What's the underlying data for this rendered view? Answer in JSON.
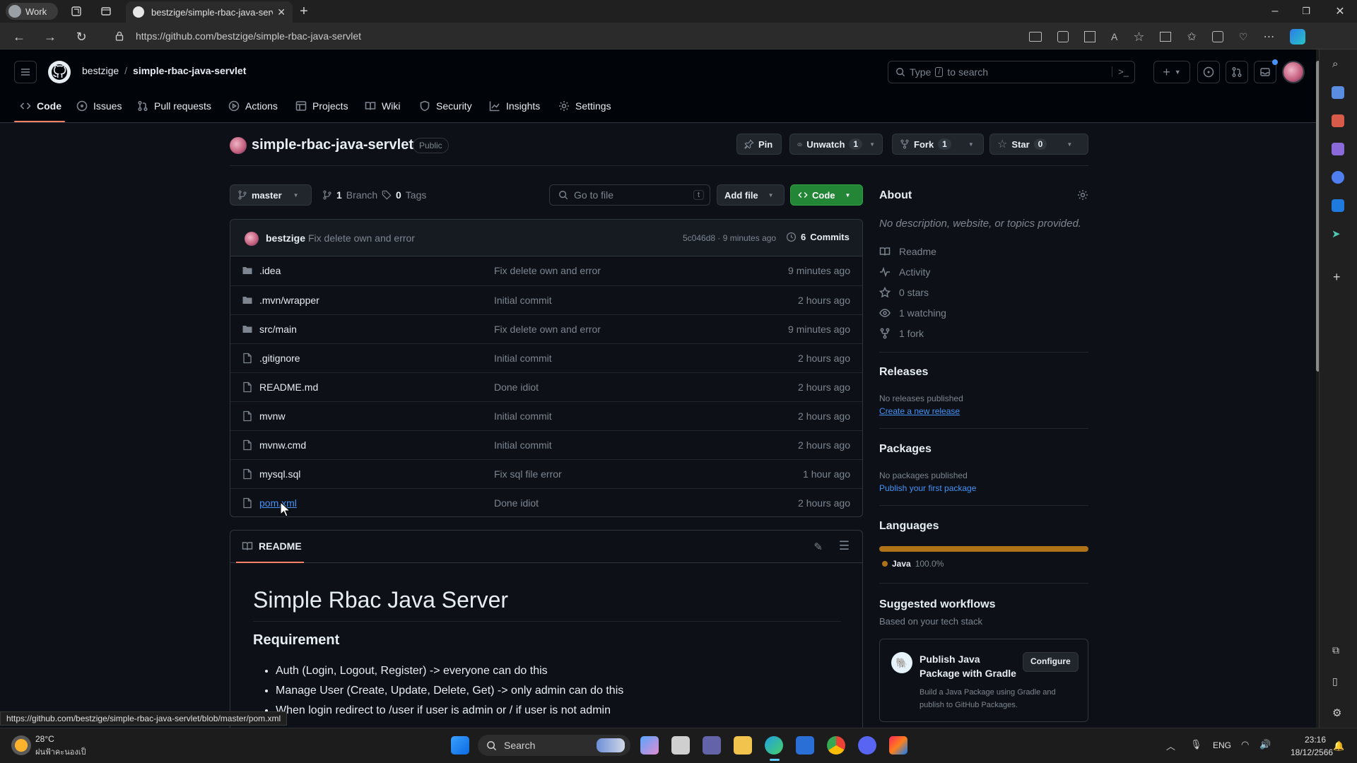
{
  "browser": {
    "profile_label": "Work",
    "tab_title": "bestzige/simple-rbac-java-servle",
    "url": "https://github.com/bestzige/simple-rbac-java-servlet",
    "status_url": "https://github.com/bestzige/simple-rbac-java-servlet/blob/master/pom.xml"
  },
  "header": {
    "owner": "bestzige",
    "separator": "/",
    "repo": "simple-rbac-java-servlet",
    "search_prefix": "Type",
    "search_key": "/",
    "search_suffix": "to search"
  },
  "nav": {
    "tabs": [
      {
        "label": "Code",
        "icon": "code-icon"
      },
      {
        "label": "Issues",
        "icon": "issues-icon"
      },
      {
        "label": "Pull requests",
        "icon": "pull-request-icon"
      },
      {
        "label": "Actions",
        "icon": "actions-icon"
      },
      {
        "label": "Projects",
        "icon": "projects-icon"
      },
      {
        "label": "Wiki",
        "icon": "book-icon"
      },
      {
        "label": "Security",
        "icon": "shield-icon"
      },
      {
        "label": "Insights",
        "icon": "graph-icon"
      },
      {
        "label": "Settings",
        "icon": "gear-icon"
      }
    ]
  },
  "repo": {
    "name": "simple-rbac-java-servlet",
    "visibility": "Public",
    "pin_label": "Pin",
    "unwatch_label": "Unwatch",
    "watch_count": "1",
    "fork_label": "Fork",
    "fork_count": "1",
    "star_label": "Star",
    "star_count": "0"
  },
  "toolbar": {
    "branch": "master",
    "branch_count": "1",
    "branch_label": "Branch",
    "tag_count": "0",
    "tag_label": "Tags",
    "go_to_file": "Go to file",
    "go_to_file_key": "t",
    "add_file": "Add file",
    "code": "Code"
  },
  "commit": {
    "author": "bestzige",
    "message": "Fix delete own and error",
    "hash_time": "5c046d8 · 9 minutes ago",
    "commits_count": "6",
    "commits_label": "Commits"
  },
  "files": [
    {
      "name": ".idea",
      "type": "folder",
      "message": "Fix delete own and error",
      "date": "9 minutes ago"
    },
    {
      "name": ".mvn/wrapper",
      "type": "folder",
      "message": "Initial commit",
      "date": "2 hours ago"
    },
    {
      "name": "src/main",
      "type": "folder",
      "message": "Fix delete own and error",
      "date": "9 minutes ago"
    },
    {
      "name": ".gitignore",
      "type": "file",
      "message": "Initial commit",
      "date": "2 hours ago"
    },
    {
      "name": "README.md",
      "type": "file",
      "message": "Done idiot",
      "date": "2 hours ago"
    },
    {
      "name": "mvnw",
      "type": "file",
      "message": "Initial commit",
      "date": "2 hours ago"
    },
    {
      "name": "mvnw.cmd",
      "type": "file",
      "message": "Initial commit",
      "date": "2 hours ago"
    },
    {
      "name": "mysql.sql",
      "type": "file",
      "message": "Fix sql file error",
      "date": "1 hour ago"
    },
    {
      "name": "pom.xml",
      "type": "file",
      "message": "Done idiot",
      "date": "2 hours ago"
    }
  ],
  "readme": {
    "tab_label": "README",
    "title": "Simple Rbac Java Server",
    "section": "Requirement",
    "bullets": [
      "Auth (Login, Logout, Register) -> everyone can do this",
      "Manage User (Create, Update, Delete, Get) -> only admin can do this",
      "When login redirect to /user if user is admin or / if user is not admin"
    ]
  },
  "about": {
    "title": "About",
    "description": "No description, website, or topics provided.",
    "items": [
      "Readme",
      "Activity",
      "0 stars",
      "1 watching",
      "1 fork"
    ]
  },
  "releases": {
    "title": "Releases",
    "none": "No releases published",
    "link": "Create a new release"
  },
  "packages": {
    "title": "Packages",
    "none": "No packages published",
    "link": "Publish your first package"
  },
  "languages": {
    "title": "Languages",
    "name": "Java",
    "percent": "100.0%",
    "color": "#b07219",
    "fraction": 1.0
  },
  "workflows": {
    "title": "Suggested workflows",
    "subtitle": "Based on your tech stack",
    "card_title": "Publish Java Package with Gradle",
    "card_desc": "Build a Java Package using Gradle and publish to GitHub Packages.",
    "configure": "Configure"
  },
  "taskbar": {
    "temperature": "28°C",
    "weather_text": "ฝนฟ้าคะนองเป็นบางแห่ง",
    "search": "Search",
    "lang": "ENG",
    "time": "23:16",
    "date": "18/12/2566"
  },
  "colors": {
    "accent_green": "#238636",
    "link_blue": "#4493f8",
    "bg": "#0d1117"
  }
}
